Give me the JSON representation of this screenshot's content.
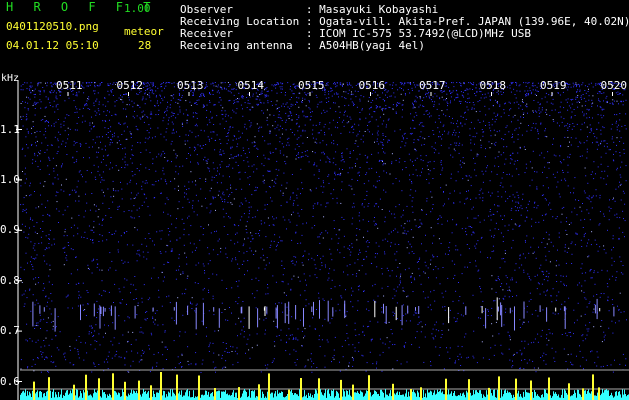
{
  "header": {
    "title": "H R O F F T",
    "version": "1.00",
    "file": "0401120510.png",
    "datetime": "04.01.12 05:10",
    "meteor_label": "meteor",
    "meteor_count": "28"
  },
  "info": [
    "Observer           : Masayuki Kobayashi",
    "Receiving Location : Ogata-vill. Akita-Pref. JAPAN (139.96E, 40.02N)",
    "Receiver           : ICOM IC-575 53.7492(@LCD)MHz USB",
    "Receiving antenna  : A504HB(yagi 4el)"
  ],
  "axis": {
    "unit": "kHz",
    "freq_ticks": [
      {
        "label": "1.1",
        "value": 1.1
      },
      {
        "label": "1.0",
        "value": 1.0
      },
      {
        "label": "0.9",
        "value": 0.9
      },
      {
        "label": "0.8",
        "value": 0.8
      },
      {
        "label": "0.7",
        "value": 0.7
      },
      {
        "label": "0.6",
        "value": 0.6
      }
    ],
    "time_ticks": [
      "0511",
      "0512",
      "0513",
      "0514",
      "0515",
      "0516",
      "0517",
      "0518",
      "0519",
      "0520"
    ]
  },
  "colors": {
    "title": "#22dd22",
    "text": "#ffff33",
    "info": "#ffffff",
    "axis_label": "#ffffff",
    "noise": "#3030ff",
    "echo": "#8888ff",
    "level_line": "#ffff33",
    "level_noise": "#33ffff",
    "guide_line": "#aaaaaa"
  }
}
